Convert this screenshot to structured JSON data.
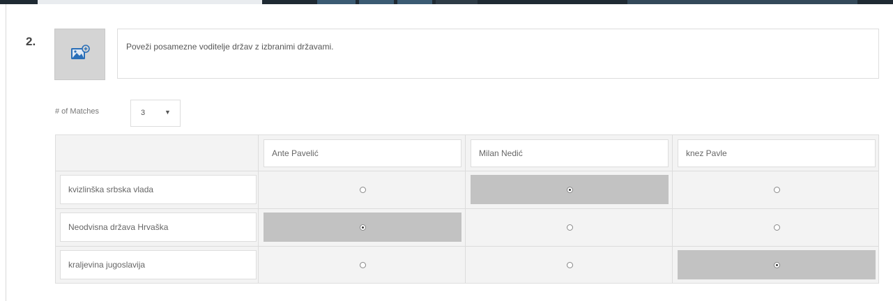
{
  "question": {
    "number": "2.",
    "text": "Poveži posamezne voditelje držav z izbranimi državami.",
    "image_button_icon": "image-add-icon"
  },
  "matches": {
    "label": "# of Matches",
    "selected": "3"
  },
  "grid": {
    "columns": [
      "Ante Pavelić",
      "Milan Nedić",
      "knez Pavle"
    ],
    "rows": [
      {
        "label": "kvizlinška srbska vlada",
        "selected_col": 1
      },
      {
        "label": "Neodvisna država Hrvaška",
        "selected_col": 0
      },
      {
        "label": "kraljevina jugoslavija",
        "selected_col": 2
      }
    ]
  },
  "colors": {
    "selected_cell": "#c2c2c2",
    "icon_blue": "#2a6fb8"
  }
}
